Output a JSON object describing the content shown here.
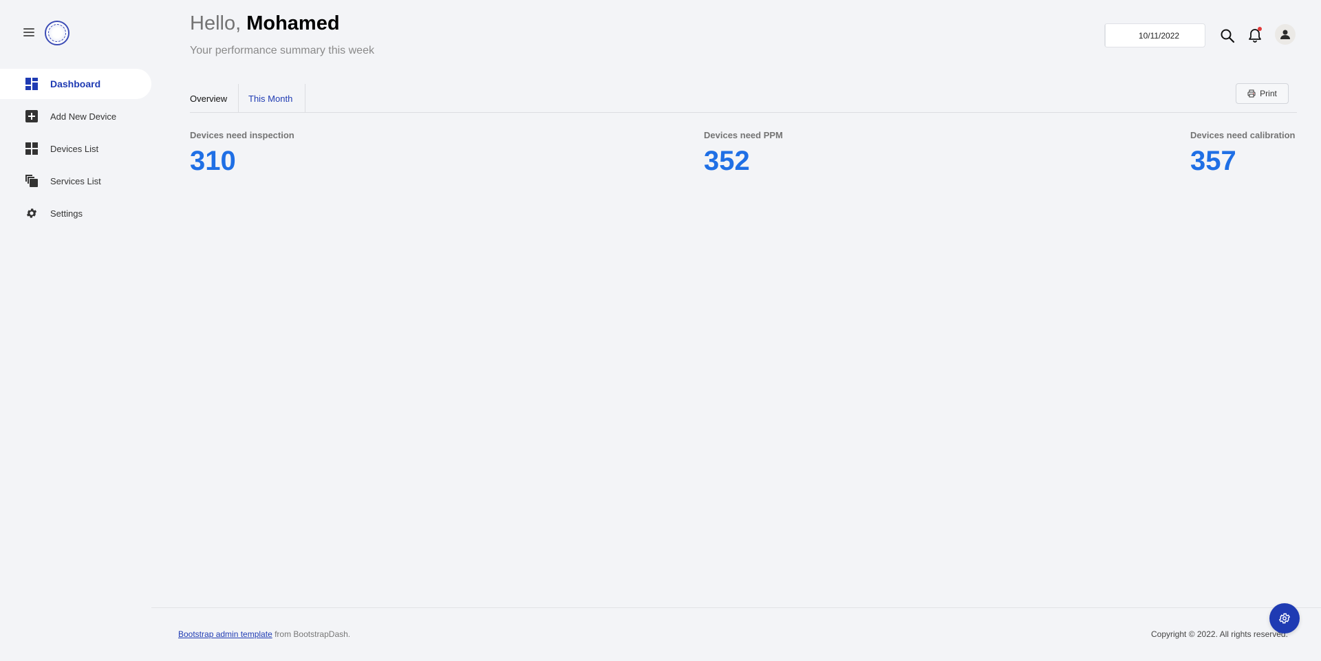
{
  "header": {
    "greeting_prefix": "Hello,",
    "user_name": "Mohamed",
    "subtitle": "Your performance summary this week",
    "date_value": "10/11/2022"
  },
  "sidebar": {
    "items": [
      {
        "label": "Dashboard",
        "icon": "dashboard-icon",
        "active": true
      },
      {
        "label": "Add New Device",
        "icon": "add-box-icon"
      },
      {
        "label": "Devices List",
        "icon": "grid-icon"
      },
      {
        "label": "Services List",
        "icon": "copy-icon"
      },
      {
        "label": "Settings",
        "icon": "gear-icon"
      }
    ]
  },
  "tabs": [
    {
      "label": "Overview"
    },
    {
      "label": "This Month"
    }
  ],
  "toolbar": {
    "print_label": "Print"
  },
  "stats": [
    {
      "label": "Devices need inspection",
      "value": "310"
    },
    {
      "label": "Devices need PPM",
      "value": "352"
    },
    {
      "label": "Devices need calibration",
      "value": "357"
    }
  ],
  "footer": {
    "link_text": "Bootstrap admin template",
    "link_suffix": " from BootstrapDash.",
    "copyright": "Copyright © 2022. All rights reserved."
  },
  "colors": {
    "accent": "#1f3bb3",
    "stat_value": "#1f6fe5",
    "notification_dot": "#e23a3a",
    "background": "#f3f4f7"
  }
}
